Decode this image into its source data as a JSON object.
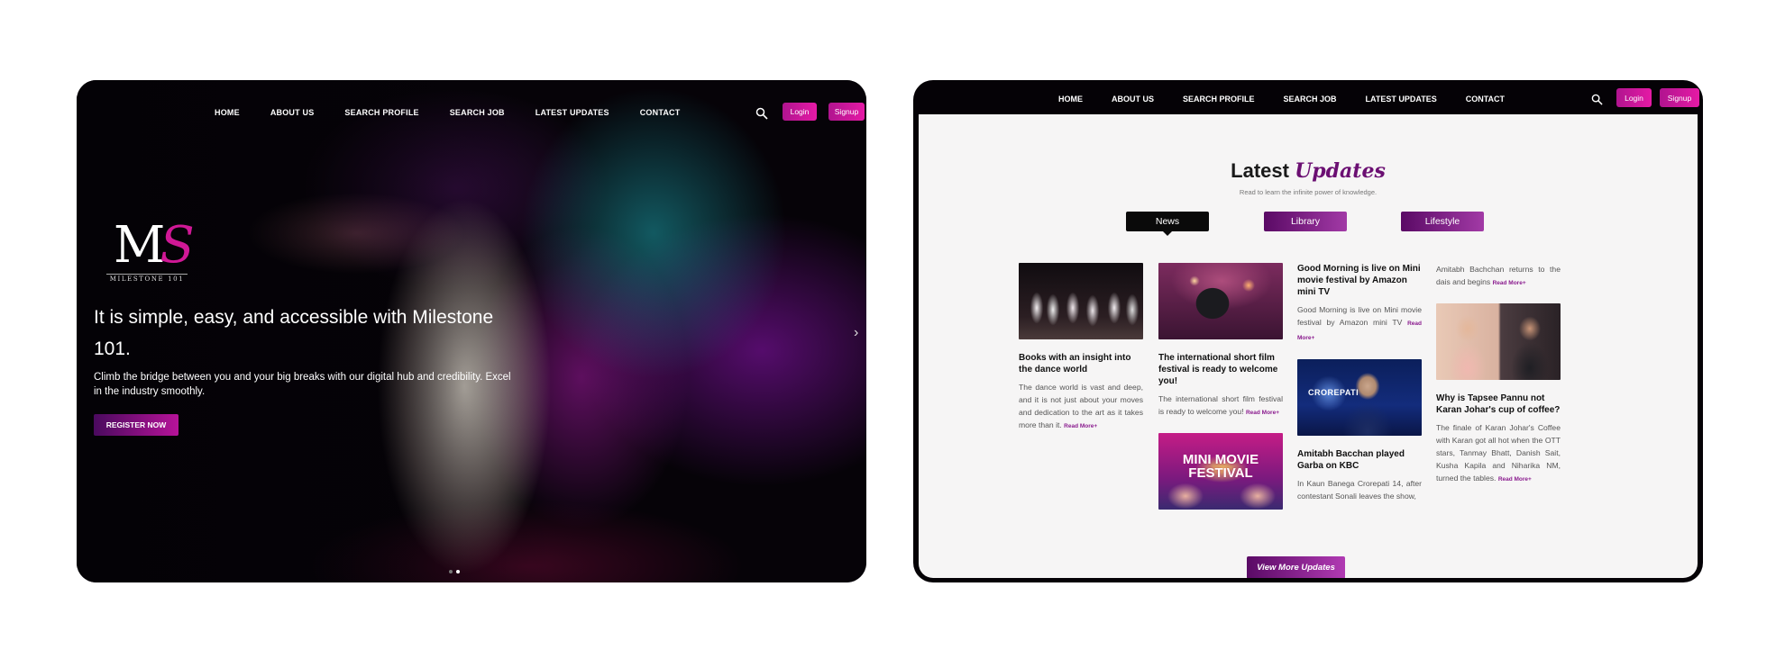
{
  "nav": {
    "items": [
      "HOME",
      "ABOUT US",
      "SEARCH PROFILE",
      "SEARCH JOB",
      "LATEST UPDATES",
      "CONTACT"
    ],
    "login_label": "Login",
    "signup_label": "Signup",
    "search_icon": "search-icon"
  },
  "hero": {
    "logo_mark": "MS",
    "logo_sub": "MILESTONE 101",
    "title": "It is simple, easy, and accessible with Milestone 101.",
    "description": "Climb the bridge between you and your big breaks with our digital hub and credibility. Excel in the industry smoothly.",
    "register_label": "REGISTER NOW",
    "next_icon": "chevron-right-icon",
    "slides_count": 2,
    "active_slide": 2
  },
  "updates": {
    "title_plain": "Latest",
    "title_highlight": "Updates",
    "subtitle": "Read to learn the infinite power of knowledge.",
    "tabs": [
      "News",
      "Library",
      "Lifestyle"
    ],
    "active_tab": "News",
    "read_more": "Read More+",
    "cards": [
      {
        "title": "Books with an insight into the dance world",
        "body": "The dance world is vast and deep, and it is not just about your moves and dedication to the art as it takes more than it."
      },
      {
        "title": "The international short film festival is ready to welcome you!",
        "body": "The international short film festival is ready to welcome you!"
      },
      {
        "title": "Good Morning is live on Mini movie festival by Amazon mini TV",
        "body": "Good Morning is live on Mini movie festival by Amazon mini TV"
      },
      {
        "title": "Amitabh Bacchan played Garba on KBC",
        "body": "In Kaun Banega Crorepati 14, after contestant Sonali leaves the show,"
      },
      {
        "title": "",
        "body": "Amitabh Bachchan returns to the dais and begins"
      },
      {
        "title": "Why is Tapsee Pannu not Karan Johar's cup of coffee?",
        "body": "The finale of Karan Johar's Coffee with Karan got all hot when the OTT stars, Tanmay Bhatt, Danish Sait, Kusha Kapila and Niharika NM, turned the tables."
      }
    ],
    "festival_image_text": "MINI MOVIE FESTIVAL",
    "kbc_image_text": "CROREPATI",
    "view_more_label": "View More Updates"
  },
  "colors": {
    "accent": "#b0148f",
    "accent_dark": "#5a0a65",
    "background": "#f6f5f5",
    "device_frame": "#050206"
  }
}
